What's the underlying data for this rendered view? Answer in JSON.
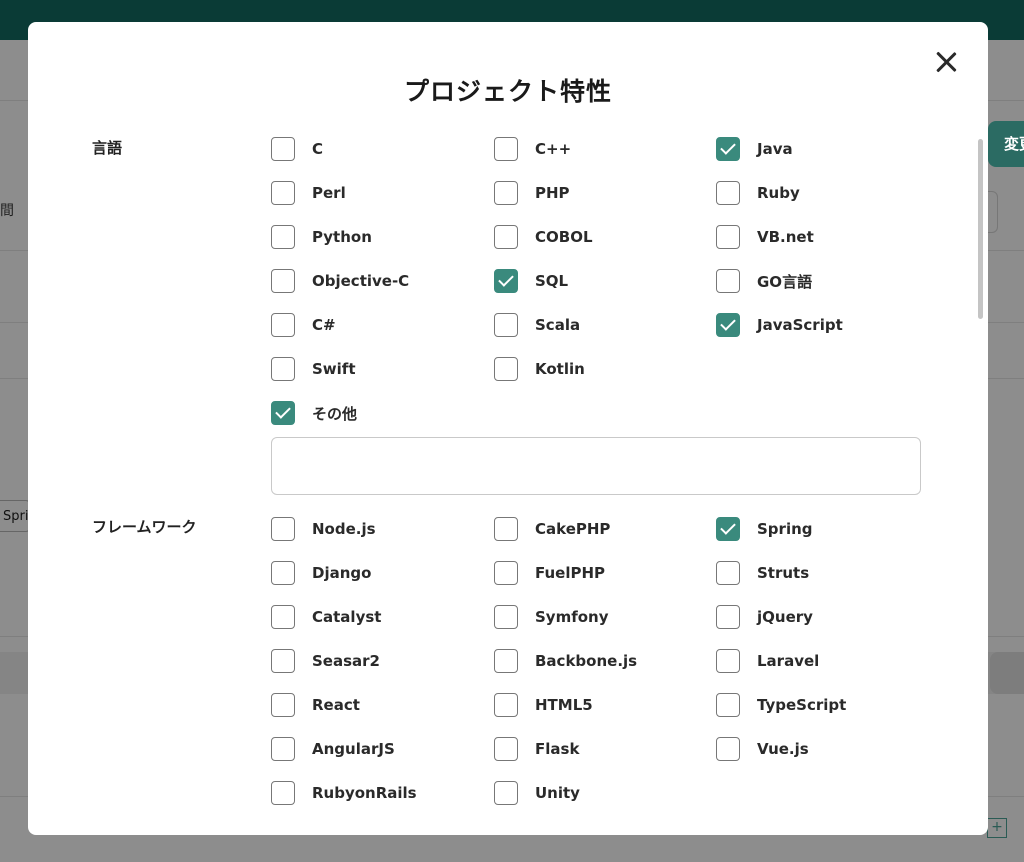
{
  "background": {
    "left_label": "間",
    "change_button_label": "変更",
    "tag_text": "Spring"
  },
  "modal": {
    "title": "プロジェクト特性",
    "other_input": {
      "value": "",
      "placeholder": ""
    }
  },
  "sections": {
    "languages": {
      "label": "言語",
      "items": [
        {
          "label": "C",
          "checked": false
        },
        {
          "label": "C++",
          "checked": false
        },
        {
          "label": "Java",
          "checked": true
        },
        {
          "label": "Perl",
          "checked": false
        },
        {
          "label": "PHP",
          "checked": false
        },
        {
          "label": "Ruby",
          "checked": false
        },
        {
          "label": "Python",
          "checked": false
        },
        {
          "label": "COBOL",
          "checked": false
        },
        {
          "label": "VB.net",
          "checked": false
        },
        {
          "label": "Objective-C",
          "checked": false
        },
        {
          "label": "SQL",
          "checked": true
        },
        {
          "label": "GO言語",
          "checked": false
        },
        {
          "label": "C#",
          "checked": false
        },
        {
          "label": "Scala",
          "checked": false
        },
        {
          "label": "JavaScript",
          "checked": true
        },
        {
          "label": "Swift",
          "checked": false
        },
        {
          "label": "Kotlin",
          "checked": false
        },
        {
          "label": "その他",
          "checked": true
        }
      ]
    },
    "frameworks": {
      "label": "フレームワーク",
      "items": [
        {
          "label": "Node.js",
          "checked": false
        },
        {
          "label": "CakePHP",
          "checked": false
        },
        {
          "label": "Spring",
          "checked": true
        },
        {
          "label": "Django",
          "checked": false
        },
        {
          "label": "FuelPHP",
          "checked": false
        },
        {
          "label": "Struts",
          "checked": false
        },
        {
          "label": "Catalyst",
          "checked": false
        },
        {
          "label": "Symfony",
          "checked": false
        },
        {
          "label": "jQuery",
          "checked": false
        },
        {
          "label": "Seasar2",
          "checked": false
        },
        {
          "label": "Backbone.js",
          "checked": false
        },
        {
          "label": "Laravel",
          "checked": false
        },
        {
          "label": "React",
          "checked": false
        },
        {
          "label": "HTML5",
          "checked": false
        },
        {
          "label": "TypeScript",
          "checked": false
        },
        {
          "label": "AngularJS",
          "checked": false
        },
        {
          "label": "Flask",
          "checked": false
        },
        {
          "label": "Vue.js",
          "checked": false
        },
        {
          "label": "RubyonRails",
          "checked": false
        },
        {
          "label": "Unity",
          "checked": false
        }
      ]
    }
  },
  "colors": {
    "accent": "#3a8a7d",
    "topbar": "#0a3b36"
  }
}
